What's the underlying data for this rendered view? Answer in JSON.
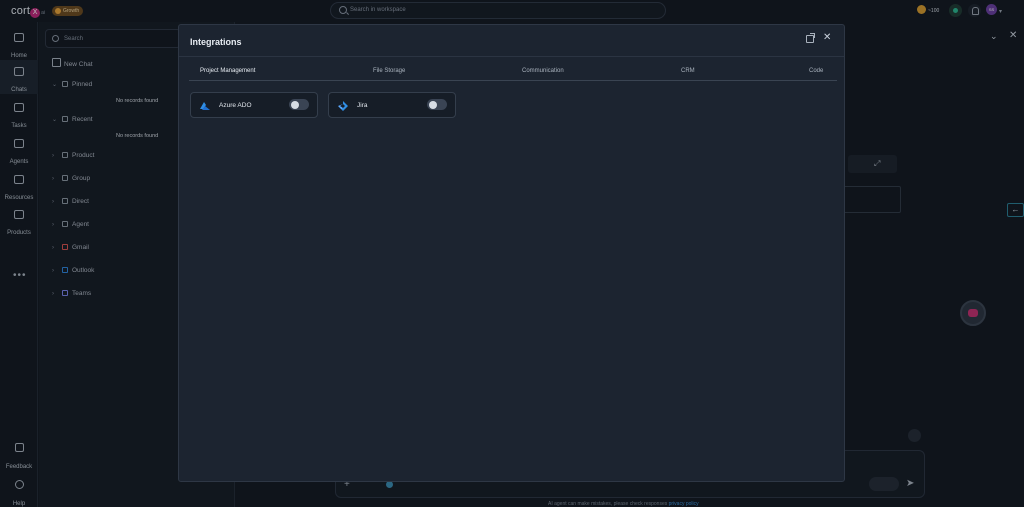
{
  "topbar": {
    "logo_text": "cort",
    "logo_mark": "X",
    "logo_suffix": "ai",
    "badge": "Growth",
    "search_placeholder": "Search in workspace",
    "credits": "~100",
    "avatar_initials": "SS"
  },
  "rail": {
    "items": [
      {
        "label": "Home",
        "icon": "home-icon"
      },
      {
        "label": "Chats",
        "icon": "chat-icon"
      },
      {
        "label": "Tasks",
        "icon": "tasks-icon"
      },
      {
        "label": "Agents",
        "icon": "agents-icon"
      },
      {
        "label": "Resources",
        "icon": "resources-icon"
      },
      {
        "label": "Products",
        "icon": "products-icon"
      }
    ],
    "more": "•••",
    "feedback": "Feedback",
    "help": "Help"
  },
  "side": {
    "search_placeholder": "Search",
    "new_chat": "New Chat",
    "sections": [
      "Pinned",
      "Recent",
      "Product",
      "Group",
      "Direct",
      "Agent",
      "Gmail",
      "Outlook",
      "Teams"
    ],
    "no_records": "No records found"
  },
  "modal": {
    "title": "Integrations",
    "tabs": [
      "Project Management",
      "File Storage",
      "Communication",
      "CRM",
      "Code"
    ],
    "active_tab": "Project Management",
    "integrations": [
      {
        "name": "Azure ADO",
        "enabled": false
      },
      {
        "name": "Jira",
        "enabled": false
      }
    ]
  },
  "footer": {
    "disclaimer": "AI agent can make mistakes, please check responses",
    "privacy_link": "privacy policy"
  },
  "colors": {
    "background": "#121820",
    "modal": "#1c2430",
    "accent": "#3b8fd6",
    "brand": "#c0287a"
  }
}
